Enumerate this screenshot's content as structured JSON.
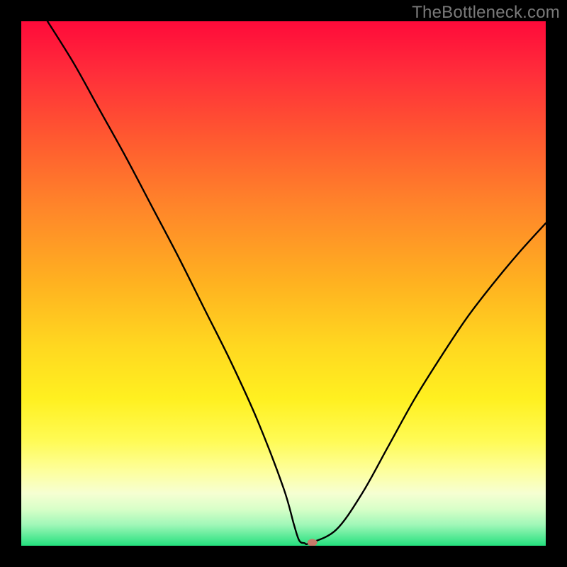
{
  "watermark": "TheBottleneck.com",
  "colors": {
    "gradient_top": "#ff0a3a",
    "gradient_mid": "#ffd820",
    "gradient_bottom": "#24e07e",
    "curve": "#000000",
    "marker": "#c77a6a",
    "frame_bg": "#000000"
  },
  "chart_data": {
    "type": "line",
    "title": "",
    "xlabel": "",
    "ylabel": "",
    "xlim": [
      0,
      100
    ],
    "ylim": [
      0,
      100
    ],
    "x": [
      5,
      10,
      15,
      20,
      25,
      30,
      35,
      40,
      45,
      50,
      52,
      53,
      54,
      55,
      60,
      65,
      70,
      75,
      80,
      85,
      90,
      95,
      100
    ],
    "values": [
      100,
      92,
      83,
      74,
      64.5,
      55,
      45,
      35,
      24,
      11,
      4,
      1,
      0.5,
      0.5,
      3,
      10,
      19,
      28,
      36,
      43.5,
      50,
      56,
      61.5
    ],
    "flat_floor_segment": {
      "x_start": 50,
      "x_end": 55,
      "y": 0.5
    },
    "marker": {
      "x": 55.5,
      "y": 0.6
    },
    "annotations": []
  }
}
